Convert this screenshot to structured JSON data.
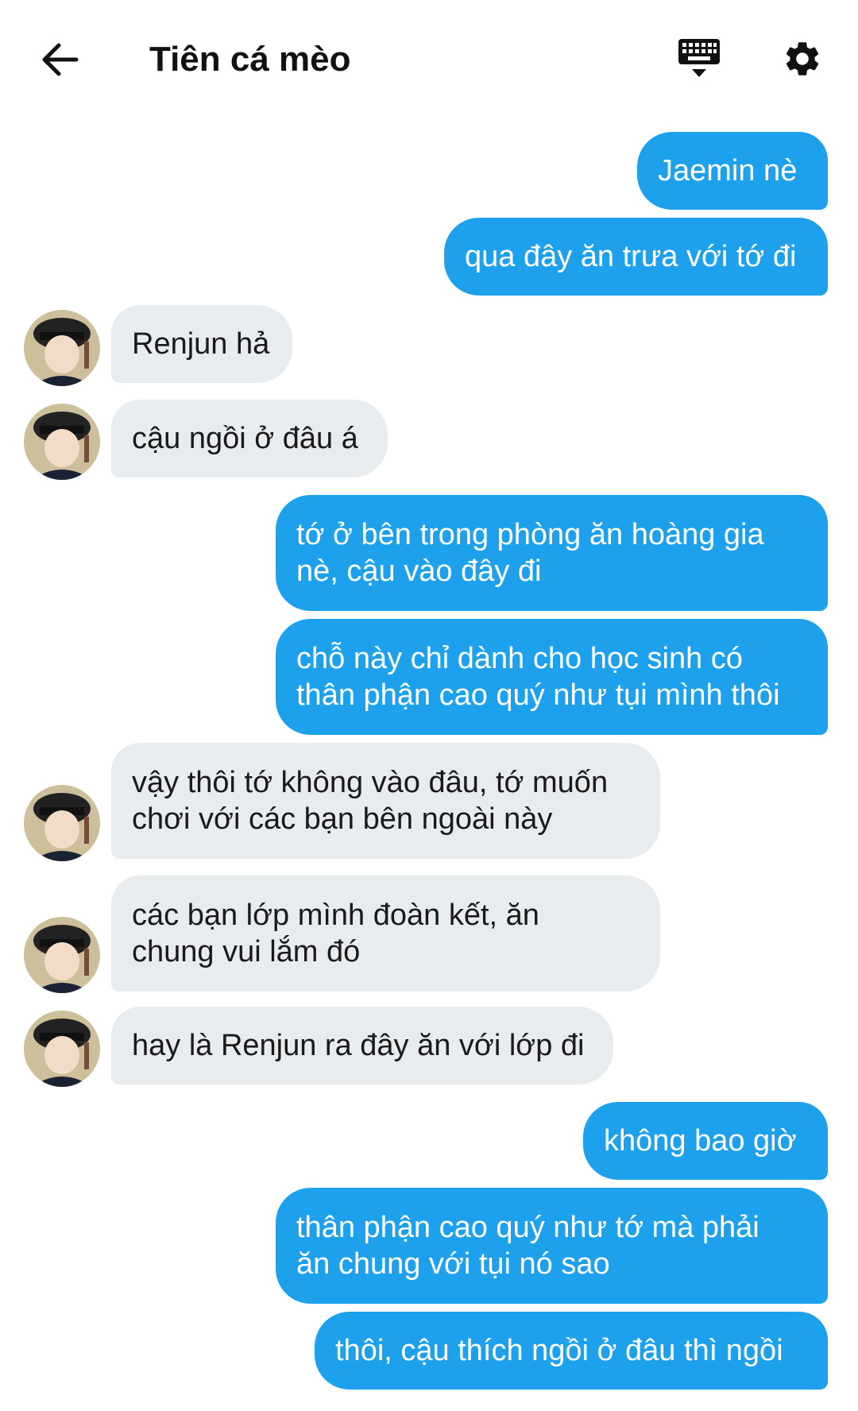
{
  "header": {
    "title": "Tiên cá mèo",
    "back_icon": "arrow-left-icon",
    "keyboard_icon": "keyboard-icon",
    "settings_icon": "gear-icon"
  },
  "colors": {
    "outgoing_bubble": "#1da1ec",
    "incoming_bubble": "#e9ecef",
    "outgoing_text": "#ffffff",
    "incoming_text": "#1a1a1a"
  },
  "messages": [
    {
      "side": "out",
      "text": "Jaemin nè"
    },
    {
      "side": "out",
      "text": "qua đây ăn trưa với tớ đi"
    },
    {
      "side": "in",
      "text": "Renjun hả"
    },
    {
      "side": "in",
      "text": "cậu ngồi ở đâu á"
    },
    {
      "side": "out",
      "text": "tớ ở bên trong phòng ăn hoàng gia\nnè, cậu vào đây đi"
    },
    {
      "side": "out",
      "text": "chỗ này chỉ dành cho học sinh có\nthân phận cao quý như tụi mình thôi"
    },
    {
      "side": "in",
      "text": "vậy thôi tớ không vào đâu, tớ muốn\nchơi với các bạn bên ngoài này"
    },
    {
      "side": "in",
      "text": "các bạn lớp mình đoàn kết, ăn\nchung vui lắm đó"
    },
    {
      "side": "in",
      "text": "hay là Renjun ra đây ăn với lớp đi"
    },
    {
      "side": "out",
      "text": "không bao giờ"
    },
    {
      "side": "out",
      "text": "thân phận cao quý như tớ mà phải\năn chung với tụi nó sao"
    },
    {
      "side": "out",
      "text": "thôi, cậu thích ngồi ở đâu thì ngồi"
    }
  ]
}
